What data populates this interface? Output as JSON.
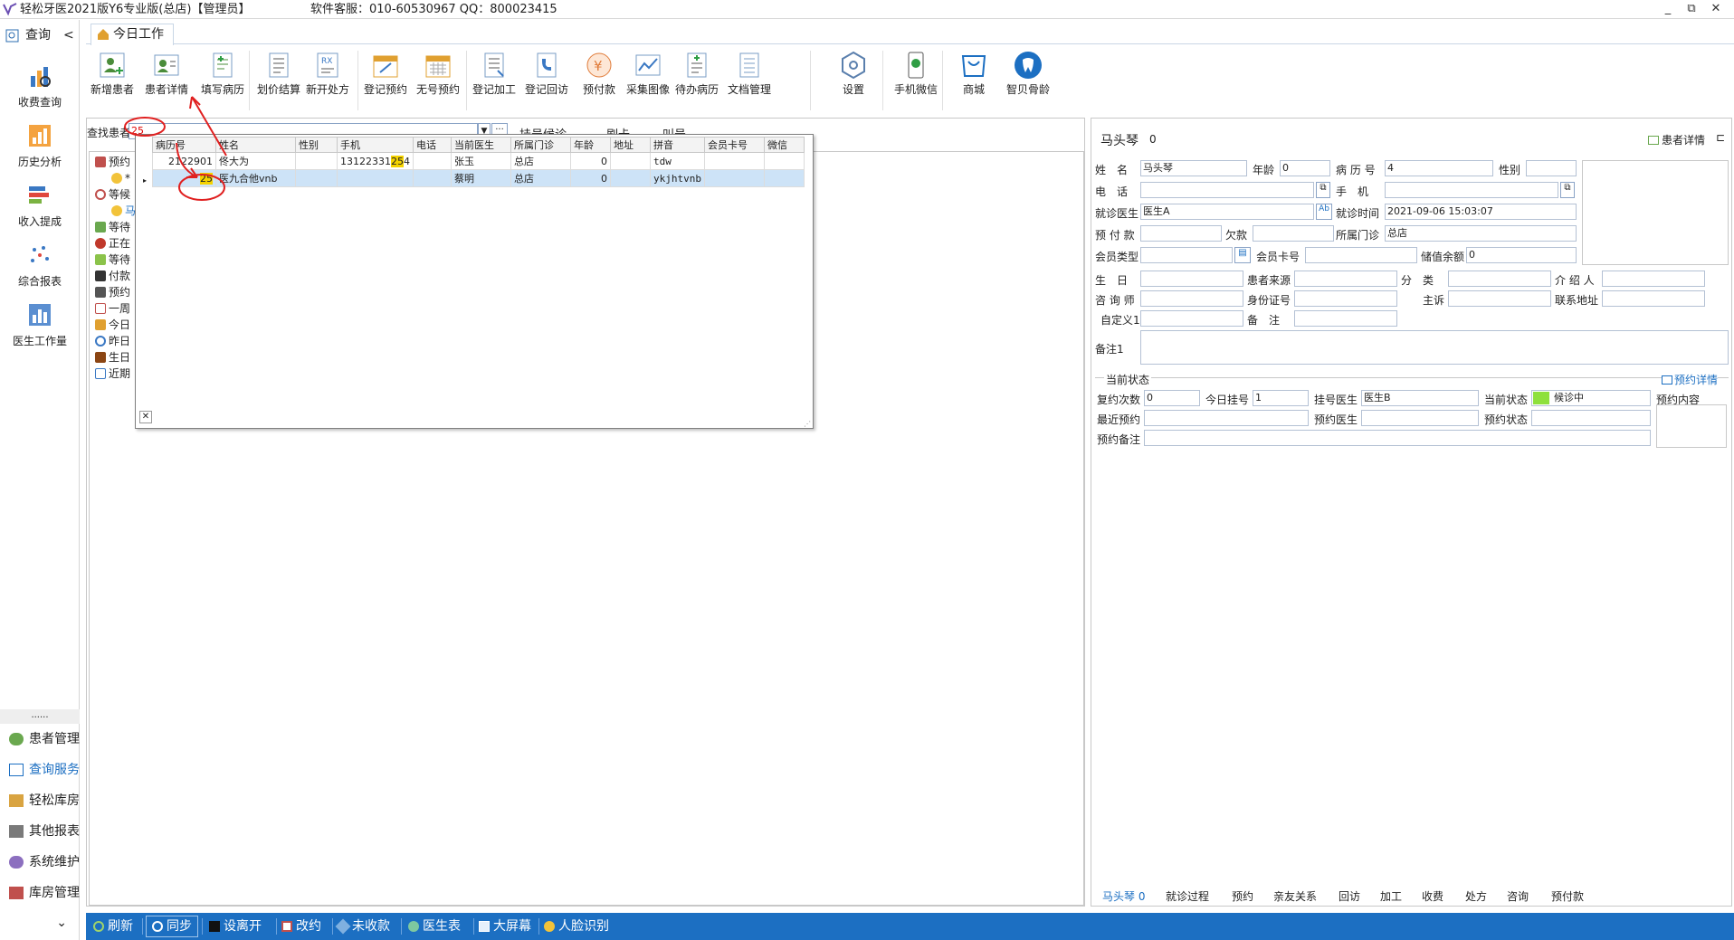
{
  "window": {
    "title": "轻松牙医2021版Y6专业版(总店)【管理员】",
    "support": "软件客服：010-60530967 QQ：800023415",
    "min": "_",
    "restore": "⧉",
    "close": "✕"
  },
  "sidebar": {
    "head": "查询",
    "collapse": "<",
    "items": [
      {
        "label": "收费查询"
      },
      {
        "label": "历史分析"
      },
      {
        "label": "收入提成"
      },
      {
        "label": "综合报表"
      },
      {
        "label": "医生工作量"
      }
    ],
    "dots": "......",
    "bottom": [
      {
        "label": "患者管理"
      },
      {
        "label": "查询服务"
      },
      {
        "label": "轻松库房"
      },
      {
        "label": "其他报表"
      },
      {
        "label": "系统维护"
      },
      {
        "label": "库房管理"
      }
    ],
    "expand": "⌄"
  },
  "tabs": [
    {
      "label": "今日工作"
    }
  ],
  "ribbon": [
    {
      "label": "新增患者"
    },
    {
      "label": "患者详情"
    },
    {
      "label": "填写病历"
    },
    {
      "label": "划价结算"
    },
    {
      "label": "新开处方"
    },
    {
      "label": "登记预约"
    },
    {
      "label": "无号预约"
    },
    {
      "label": "登记加工"
    },
    {
      "label": "登记回访"
    },
    {
      "label": "预付款"
    },
    {
      "label": "采集图像"
    },
    {
      "label": "待办病历"
    },
    {
      "label": "文档管理"
    },
    {
      "label": "设置"
    },
    {
      "label": "手机微信"
    },
    {
      "label": "商城"
    },
    {
      "label": "智贝骨龄"
    }
  ],
  "search": {
    "label": "查找患者",
    "value": "25",
    "hidden_buttons": [
      "挂号候诊",
      "刷卡",
      "叫号"
    ]
  },
  "tree": [
    {
      "label": "预约"
    },
    {
      "label": "*"
    },
    {
      "label": "等候"
    },
    {
      "label": "马"
    },
    {
      "label": "等待"
    },
    {
      "label": "正在"
    },
    {
      "label": "等待"
    },
    {
      "label": "付款"
    },
    {
      "label": "预约"
    },
    {
      "label": "一周"
    },
    {
      "label": "今日"
    },
    {
      "label": "昨日"
    },
    {
      "label": "生日"
    },
    {
      "label": "近期"
    }
  ],
  "popup": {
    "columns": [
      "病历号",
      "姓名",
      "性别",
      "手机",
      "电话",
      "当前医生",
      "所属门诊",
      "年龄",
      "地址",
      "拼音",
      "会员卡号",
      "微信"
    ],
    "rows": [
      {
        "id": "2122901",
        "name": "佟大为",
        "gender": "",
        "phone_pre": "13122331",
        "phone_hl": "25",
        "phone_post": "4",
        "tel": "",
        "doctor": "张玉",
        "clinic": "总店",
        "age": "0",
        "addr": "",
        "pinyin": "tdw",
        "card": "",
        "wechat": ""
      },
      {
        "id": "25",
        "name": "医九合他vnb",
        "gender": "",
        "phone_pre": "",
        "phone_hl": "",
        "phone_post": "",
        "tel": "",
        "doctor": "蔡明",
        "clinic": "总店",
        "age": "0",
        "addr": "",
        "pinyin": "ykjhtvnb",
        "card": "",
        "wechat": ""
      }
    ],
    "close": "✕"
  },
  "patient": {
    "header_name": "马头琴",
    "header_count": "0",
    "detail_btn": "患者详情",
    "labels": {
      "name": "姓　名",
      "age": "年龄",
      "record": "病 历 号",
      "gender": "性别",
      "tel": "电　话",
      "mobile": "手　机",
      "doctor": "就诊医生",
      "visit_time": "就诊时间",
      "prepay": "预 付 款",
      "debt": "欠款",
      "clinic": "所属门诊",
      "member_type": "会员类型",
      "member_card": "会员卡号",
      "balance": "储值余额",
      "birthday": "生　日",
      "source": "患者来源",
      "category": "分　类",
      "referrer": "介 绍 人",
      "consultant": "咨 询 师",
      "idcard": "身份证号",
      "complaint": "主诉",
      "address": "联系地址",
      "custom1": "自定义1",
      "remark": "备　注",
      "note1": "备注1"
    },
    "values": {
      "name": "马头琴",
      "age": "0",
      "record": "4",
      "gender": "",
      "tel": "",
      "mobile": "",
      "doctor": "医生A",
      "visit_time": "2021-09-06 15:03:07",
      "prepay": "",
      "debt": "",
      "clinic": "总店",
      "member_type": "",
      "member_card": "",
      "balance": "0",
      "birthday": "",
      "source": "",
      "category": "",
      "referrer": "",
      "consultant": "",
      "idcard": "",
      "complaint": "",
      "address": "",
      "custom1": "",
      "remark": "",
      "note1": ""
    }
  },
  "status": {
    "title": "当前状态",
    "appt_link": "预约详情",
    "labels": {
      "visits": "复约次数",
      "today_no": "今日挂号",
      "reg_doctor": "挂号医生",
      "cur_state": "当前状态",
      "recent_appt": "最近预约",
      "appt_doctor": "预约医生",
      "appt_state": "预约状态",
      "appt_note": "预约备注",
      "appt_content": "预约内容"
    },
    "values": {
      "visits": "0",
      "today_no": "1",
      "reg_doctor": "医生B",
      "cur_state": "候诊中",
      "recent_appt": "",
      "appt_doctor": "",
      "appt_state": "",
      "appt_note": ""
    },
    "state_color": "#8ee03c"
  },
  "bottom_tabs": [
    "马头琴 0",
    "就诊过程",
    "预约",
    "亲友关系",
    "回访",
    "加工",
    "收费",
    "处方",
    "咨询",
    "预付款"
  ],
  "statusbar": [
    {
      "label": "刷新"
    },
    {
      "label": "同步"
    },
    {
      "label": "设离开"
    },
    {
      "label": "改约"
    },
    {
      "label": "未收款"
    },
    {
      "label": "医生表"
    },
    {
      "label": "大屏幕"
    },
    {
      "label": "人脸识别"
    }
  ]
}
